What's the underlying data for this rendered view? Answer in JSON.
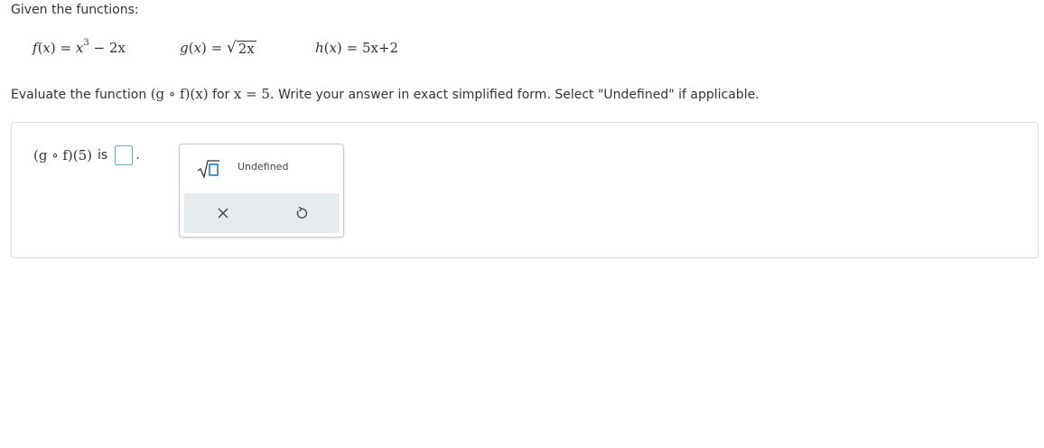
{
  "intro": "Given the functions:",
  "functions": {
    "f": {
      "lhs": "f",
      "var": "x",
      "eq": "=",
      "base": "x",
      "exp": "3",
      "rest": "− 2x"
    },
    "g": {
      "lhs": "g",
      "var": "x",
      "eq": "=",
      "radicand": "2x"
    },
    "h": {
      "lhs": "h",
      "var": "x",
      "eq": "=",
      "rhs": "5x+2"
    }
  },
  "question": {
    "before": "Evaluate the function",
    "composition": "(g ∘ f)(x)",
    "for_text": "for",
    "condition": "x = 5.",
    "after": "Write your answer in exact simplified form. Select \"Undefined\" if applicable."
  },
  "answer": {
    "expression": "(g ∘ f)(5)",
    "is_label": "is",
    "period": "."
  },
  "palette": {
    "undefined_label": "Undefined"
  },
  "colors": {
    "input_border": "#6aa8c8",
    "palette_footer": "#e6ebee"
  }
}
